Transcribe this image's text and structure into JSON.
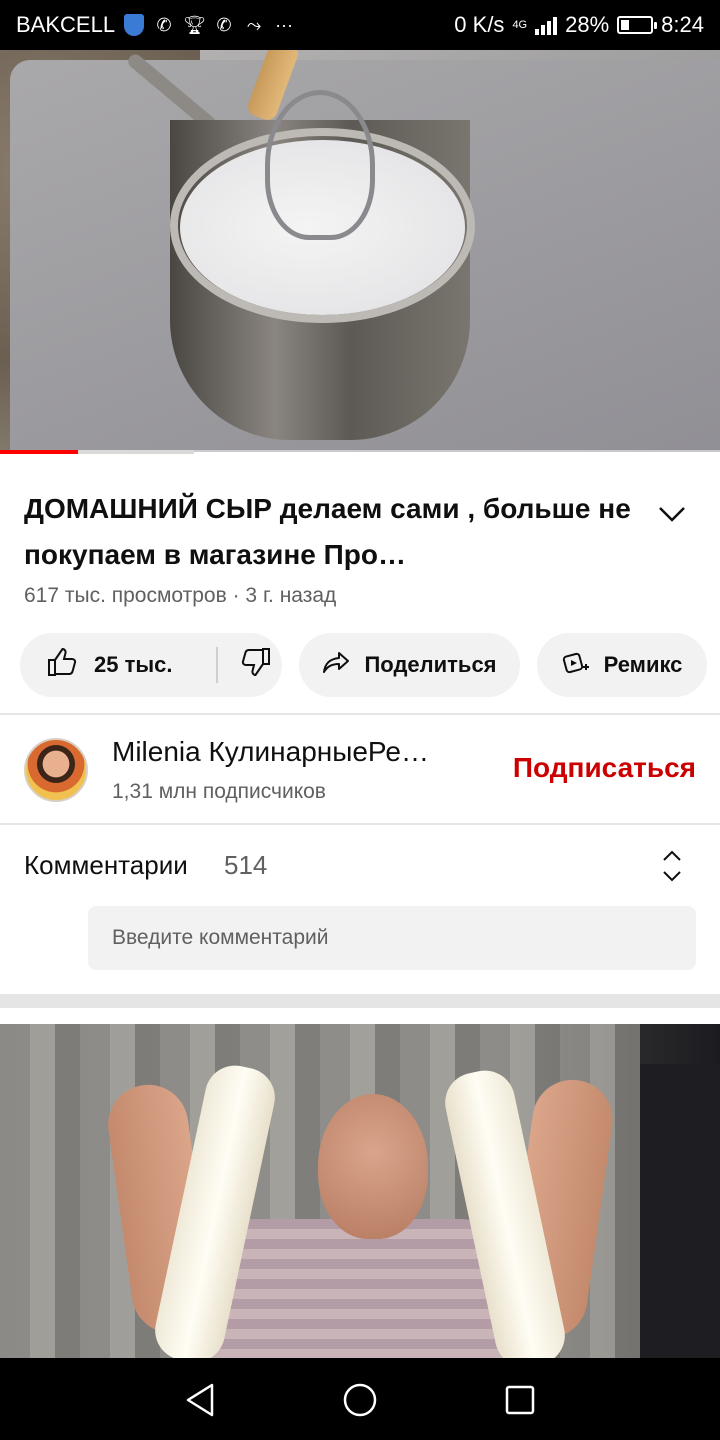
{
  "status_bar": {
    "carrier": "BAKCELL",
    "notification_icons": [
      "shield-icon",
      "wifi-calling-icon",
      "trophy-icon",
      "wifi-calling-icon",
      "missed-call-icon",
      "more-icon"
    ],
    "more": "···",
    "network_speed": "0 K/s",
    "network_type": "4G",
    "battery": "28%",
    "battery_level": 0.28,
    "time": "8:24"
  },
  "player": {
    "progress_played": 0.108,
    "progress_buffered": 0.27,
    "accent_color": "#ff0000"
  },
  "video": {
    "title": "ДОМАШНИЙ СЫР делаем сами , больше не покупаем в магазине  Про…",
    "meta": "617 тыс. просмотров · 3 г. назад"
  },
  "actions": {
    "likes": "25 тыс.",
    "share": "Поделиться",
    "remix": "Ремикс"
  },
  "channel": {
    "name": "Milenia КулинарныеРе…",
    "subscribers": "1,31 млн подписчиков",
    "subscribe": "Подписаться",
    "subscribe_color": "#cc0000"
  },
  "comments": {
    "label": "Комментарии",
    "count": "514",
    "placeholder": "Введите комментарий"
  },
  "nav": {
    "icons": [
      "back-icon",
      "home-icon",
      "recents-icon"
    ]
  }
}
